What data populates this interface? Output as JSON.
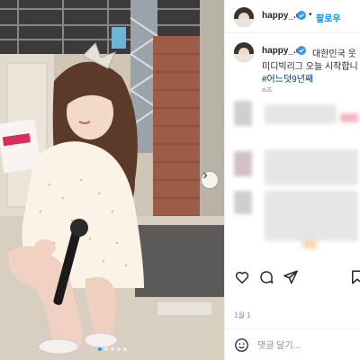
{
  "post": {
    "username": "happy_.ej",
    "separator": "•",
    "follow_label": "팔로우",
    "caption_line1": "대한민국 웃",
    "caption_line2": "미디빅리그 오늘 시작합니",
    "hashtag": "#어느덧9년째",
    "time_ago": "8주",
    "date_label": "1월 1"
  },
  "comment": {
    "placeholder": "댓글 달기..."
  },
  "icons": {
    "verified": "verified-badge-icon",
    "like": "heart-icon",
    "comment": "comment-bubble-icon",
    "share": "paper-plane-icon",
    "save": "bookmark-icon",
    "emoji": "smiley-icon",
    "next": "chevron-right-icon"
  },
  "carousel": {
    "slide_count": 5,
    "active_index": 0
  },
  "colors": {
    "accent": "#0095f6",
    "verified": "#3897f0",
    "hashtag": "#00376b",
    "muted": "#8e8e8e",
    "carousel_active_dot": "#1da1f2"
  }
}
